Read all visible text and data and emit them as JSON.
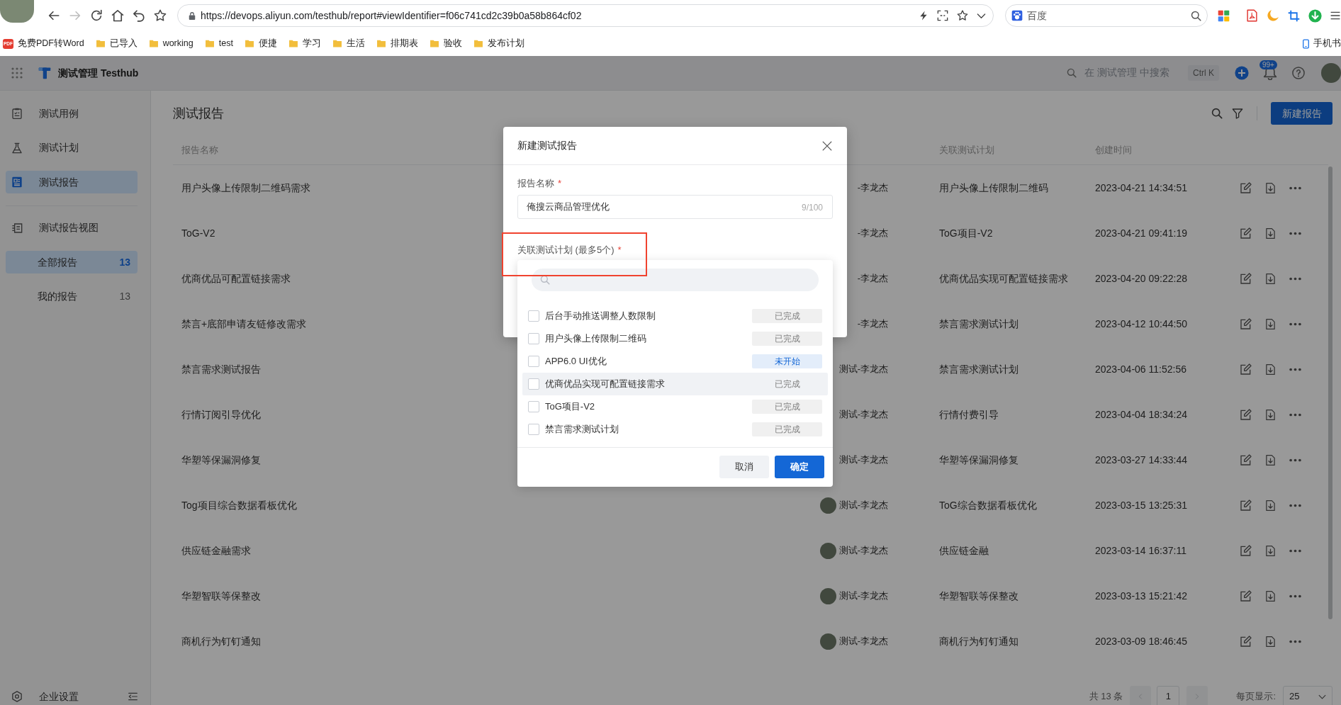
{
  "browser": {
    "url": "https://devops.aliyun.com/testhub/report#viewIdentifier=f06c741cd2c39b0a58b864cf02",
    "forward_enabled": false,
    "search_placeholder": "百度",
    "bookmarks": [
      {
        "label": "免费PDF转Word",
        "kind": "pdf",
        "badge": "PDF"
      },
      {
        "label": "已导入",
        "kind": "folder"
      },
      {
        "label": "working",
        "kind": "folder"
      },
      {
        "label": "test",
        "kind": "folder"
      },
      {
        "label": "便捷",
        "kind": "folder"
      },
      {
        "label": "学习",
        "kind": "folder"
      },
      {
        "label": "生活",
        "kind": "folder"
      },
      {
        "label": "排期表",
        "kind": "folder"
      },
      {
        "label": "验收",
        "kind": "folder"
      },
      {
        "label": "发布计划",
        "kind": "folder"
      }
    ],
    "mobile_bookmarks": "手机书"
  },
  "app_header": {
    "title": "测试管理 Testhub",
    "search_placeholder": "在 测试管理 中搜索",
    "shortcut": "Ctrl K",
    "notifications": "99+"
  },
  "sidebar": {
    "items": [
      {
        "label": "测试用例",
        "kind": "cases",
        "selected": false
      },
      {
        "label": "测试计划",
        "kind": "plans",
        "selected": false
      },
      {
        "label": "测试报告",
        "kind": "reports",
        "selected": true
      }
    ],
    "views_title": "测试报告视图",
    "views": [
      {
        "label": "全部报告",
        "count": "13",
        "selected": true
      },
      {
        "label": "我的报告",
        "count": "13",
        "selected": false
      }
    ],
    "footer": "企业设置"
  },
  "page": {
    "title": "测试报告",
    "new_button": "新建报告"
  },
  "table": {
    "columns": {
      "name": "报告名称",
      "plan": "关联测试计划",
      "created": "创建时间"
    },
    "rows": [
      {
        "name": "用户头像上传限制二维码需求",
        "creator": "-李龙杰",
        "avatar": false,
        "plan": "用户头像上传限制二维码",
        "created": "2023-04-21 14:34:51"
      },
      {
        "name": "ToG-V2",
        "creator": "-李龙杰",
        "avatar": false,
        "plan": "ToG项目-V2",
        "created": "2023-04-21 09:41:19"
      },
      {
        "name": "优商优品可配置链接需求",
        "creator": "-李龙杰",
        "avatar": false,
        "plan": "优商优品实现可配置链接需求",
        "created": "2023-04-20 09:22:28"
      },
      {
        "name": "禁言+底部申请友链修改需求",
        "creator": "-李龙杰",
        "avatar": false,
        "plan": "禁言需求测试计划",
        "created": "2023-04-12 10:44:50"
      },
      {
        "name": "禁言需求测试报告",
        "creator": "测试-李龙杰",
        "avatar": false,
        "plan": "禁言需求测试计划",
        "created": "2023-04-06 11:52:56"
      },
      {
        "name": "行情订阅引导优化",
        "creator": "测试-李龙杰",
        "avatar": false,
        "plan": "行情付费引导",
        "created": "2023-04-04 18:34:24"
      },
      {
        "name": "华塑等保漏洞修复",
        "creator": "测试-李龙杰",
        "avatar": false,
        "plan": "华塑等保漏洞修复",
        "created": "2023-03-27 14:33:44"
      },
      {
        "name": "Tog项目综合数据看板优化",
        "creator": "测试-李龙杰",
        "avatar": true,
        "plan": "ToG综合数据看板优化",
        "created": "2023-03-15 13:25:31"
      },
      {
        "name": "供应链金融需求",
        "creator": "测试-李龙杰",
        "avatar": true,
        "plan": "供应链金融",
        "created": "2023-03-14 16:37:11"
      },
      {
        "name": "华塑智联等保整改",
        "creator": "测试-李龙杰",
        "avatar": true,
        "plan": "华塑智联等保整改",
        "created": "2023-03-13 15:21:42"
      },
      {
        "name": "商机行为钉钉通知",
        "creator": "测试-李龙杰",
        "avatar": true,
        "plan": "商机行为钉钉通知",
        "created": "2023-03-09 18:46:45"
      }
    ]
  },
  "pagination": {
    "total": "共 13 条",
    "prev_enabled": false,
    "pages": [
      {
        "label": "1",
        "selected": true
      }
    ],
    "next_enabled": false,
    "page_size_label": "每页显示:",
    "page_size": "25"
  },
  "modal": {
    "title": "新建测试报告",
    "fields": [
      {
        "label": "报告名称",
        "required_mark": "*",
        "highlighted": false,
        "value": "俺搜云商品管理优化",
        "counter": "9/100"
      },
      {
        "label": "关联测试计划 (最多5个)",
        "required_mark": "*",
        "highlighted": true
      }
    ],
    "plan_options": [
      {
        "label": "后台手动推送调整人数限制",
        "checked": false,
        "hovered": false,
        "status": "已完成",
        "color": "#808080"
      },
      {
        "label": "用户头像上传限制二维码",
        "checked": false,
        "hovered": false,
        "status": "已完成",
        "color": "#808080"
      },
      {
        "label": "APP6.0 UI优化",
        "checked": false,
        "hovered": false,
        "status": "未开始",
        "color": "#1467d6"
      },
      {
        "label": "优商优品实现可配置链接需求",
        "checked": false,
        "hovered": true,
        "status": "已完成",
        "color": "#808080"
      },
      {
        "label": "ToG项目-V2",
        "checked": false,
        "hovered": false,
        "status": "已完成",
        "color": "#808080"
      },
      {
        "label": "禁言需求测试计划",
        "checked": false,
        "hovered": false,
        "status": "已完成",
        "color": "#808080"
      }
    ],
    "buttons": [
      {
        "label": "取消",
        "kind": "secondary"
      },
      {
        "label": "确定",
        "kind": "primary"
      }
    ]
  }
}
